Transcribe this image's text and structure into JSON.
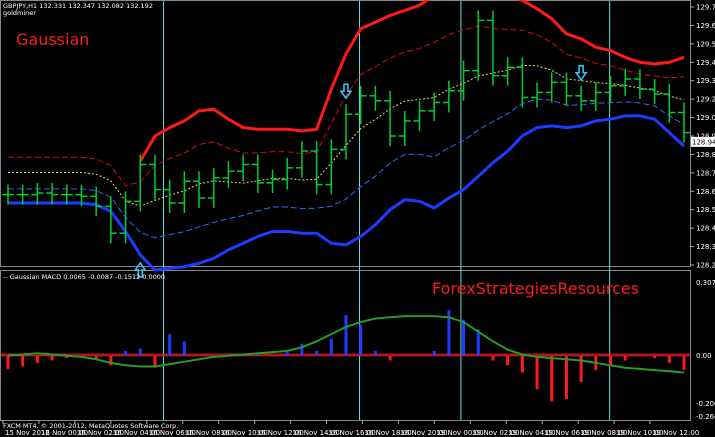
{
  "header": {
    "symbol_line": "GBPJPY,H1  132.331 132.347 132.082 132.192",
    "indicator_name": "goldminer",
    "sub_window_label": "-- Gaussian MACD 0.0065 -0.0087 -0.1512 0.0000",
    "footer": "FXCM MT4, © 2001-2012, MetaQuotes Software Corp."
  },
  "overlays": {
    "gaussian_text": "Gaussian",
    "brand_text": "ForexStrategiesResources",
    "accent_red": "#ff1a1a",
    "band_blue": "#1e3cff",
    "candle_green": "#00cc33",
    "arrow_cyan": "#33ccff",
    "vline_cyan": "#5fe0e0"
  },
  "price_axis": {
    "labels": [
      "129.750",
      "129.640",
      "129.530",
      "129.420",
      "129.310",
      "129.200",
      "129.090",
      "128.980",
      "128.870",
      "128.760",
      "128.650",
      "128.540",
      "128.430",
      "128.320",
      "128.210"
    ],
    "current_price": "128.945"
  },
  "macd_axis": {
    "labels": [
      "0.3075",
      "0.00",
      "-0.2000",
      "-0.2600"
    ]
  },
  "time_axis": {
    "labels": [
      "15 Nov 2012",
      "16 Nov 00:00",
      "16 Nov 02:00",
      "16 Nov 04:00",
      "16 Nov 06:00",
      "16 Nov 08:00",
      "16 Nov 10:00",
      "16 Nov 12:00",
      "16 Nov 14:00",
      "16 Nov 16:00",
      "16 Nov 18:00",
      "16 Nov 20:00",
      "19 Nov 00:00",
      "19 Nov 02:00",
      "19 Nov 04:00",
      "19 Nov 06:00",
      "19 Nov 08:00",
      "19 Nov 10:00",
      "19 Nov 12:00"
    ]
  },
  "chart_data": [
    {
      "type": "line",
      "title": "GBPJPY,H1",
      "ylim": [
        128.21,
        129.75
      ],
      "y_ticks": [
        129.75,
        129.64,
        129.53,
        129.42,
        129.31,
        129.2,
        129.09,
        128.98,
        128.87,
        128.76,
        128.65,
        128.54,
        128.43,
        128.32,
        128.21
      ],
      "x": [
        1,
        2,
        3,
        4,
        5,
        6,
        7,
        8,
        9,
        10,
        11,
        12,
        13,
        14,
        15,
        16,
        17,
        18,
        19,
        20,
        21,
        22,
        23,
        24,
        25,
        26,
        27,
        28,
        29,
        30,
        31,
        32,
        33,
        34,
        35,
        36,
        37,
        38,
        39,
        40,
        41,
        42,
        43,
        44,
        45,
        46,
        47
      ],
      "bars": [
        {
          "o": 128.63,
          "c": 128.63
        },
        {
          "o": 128.63,
          "c": 128.63
        },
        {
          "o": 128.63,
          "c": 128.64
        },
        {
          "o": 128.64,
          "c": 128.63
        },
        {
          "o": 128.63,
          "c": 128.63
        },
        {
          "o": 128.63,
          "c": 128.62
        },
        {
          "o": 128.62,
          "c": 128.56
        },
        {
          "o": 128.56,
          "c": 128.4
        },
        {
          "o": 128.4,
          "c": 128.59
        },
        {
          "o": 128.59,
          "c": 128.81
        },
        {
          "o": 128.81,
          "c": 128.66
        },
        {
          "o": 128.66,
          "c": 128.58
        },
        {
          "o": 128.58,
          "c": 128.71
        },
        {
          "o": 128.71,
          "c": 128.61
        },
        {
          "o": 128.61,
          "c": 128.73
        },
        {
          "o": 128.73,
          "c": 128.77
        },
        {
          "o": 128.77,
          "c": 128.81
        },
        {
          "o": 128.81,
          "c": 128.7
        },
        {
          "o": 128.7,
          "c": 128.72
        },
        {
          "o": 128.72,
          "c": 128.79
        },
        {
          "o": 128.79,
          "c": 128.89
        },
        {
          "o": 128.89,
          "c": 128.69
        },
        {
          "o": 128.69,
          "c": 128.9
        },
        {
          "o": 128.9,
          "c": 129.11
        },
        {
          "o": 129.11,
          "c": 129.22
        },
        {
          "o": 129.22,
          "c": 129.19
        },
        {
          "o": 129.19,
          "c": 128.98
        },
        {
          "o": 128.98,
          "c": 129.07
        },
        {
          "o": 129.07,
          "c": 129.13
        },
        {
          "o": 129.13,
          "c": 129.18
        },
        {
          "o": 129.18,
          "c": 129.25
        },
        {
          "o": 129.25,
          "c": 129.37
        },
        {
          "o": 129.37,
          "c": 129.67
        },
        {
          "o": 129.67,
          "c": 129.34
        },
        {
          "o": 129.34,
          "c": 129.39
        },
        {
          "o": 129.39,
          "c": 129.21
        },
        {
          "o": 129.21,
          "c": 129.24
        },
        {
          "o": 129.24,
          "c": 129.3
        },
        {
          "o": 129.3,
          "c": 129.22
        },
        {
          "o": 129.22,
          "c": 129.19
        },
        {
          "o": 129.19,
          "c": 129.24
        },
        {
          "o": 129.24,
          "c": 129.28
        },
        {
          "o": 129.28,
          "c": 129.32
        },
        {
          "o": 129.32,
          "c": 129.26
        },
        {
          "o": 129.26,
          "c": 129.23
        },
        {
          "o": 129.23,
          "c": 129.12
        },
        {
          "o": 129.12,
          "c": 129.0
        }
      ],
      "series": [
        {
          "name": "upper outer band",
          "color": "#ff1a1a",
          "values": [
            null,
            null,
            null,
            null,
            null,
            null,
            null,
            null,
            null,
            128.83,
            128.98,
            129.03,
            129.07,
            129.13,
            129.14,
            129.08,
            129.03,
            129.02,
            129.02,
            129.02,
            129.01,
            129.02,
            129.26,
            129.47,
            129.62,
            129.66,
            129.7,
            129.73,
            129.76,
            129.82,
            129.86,
            129.88,
            129.89,
            129.85,
            129.82,
            129.79,
            129.74,
            129.68,
            129.59,
            129.56,
            129.51,
            129.49,
            129.45,
            129.42,
            129.41,
            129.42,
            129.45
          ]
        },
        {
          "name": "lower outer band",
          "color": "#1e3cff",
          "values": [
            128.58,
            128.58,
            128.58,
            128.58,
            128.58,
            128.58,
            128.57,
            128.53,
            128.41,
            128.27,
            128.18,
            128.19,
            128.2,
            128.22,
            128.25,
            128.3,
            128.34,
            128.38,
            128.41,
            128.41,
            128.4,
            128.4,
            128.34,
            128.33,
            128.38,
            128.45,
            128.54,
            128.6,
            128.59,
            128.55,
            128.61,
            128.66,
            128.74,
            128.82,
            128.89,
            128.98,
            129.03,
            129.04,
            129.03,
            129.04,
            129.07,
            129.08,
            129.1,
            129.1,
            129.08,
            129.0,
            128.92
          ]
        }
      ],
      "annotations": [
        {
          "label": "Gaussian"
        },
        {
          "type": "buy-arrow",
          "x": 10
        },
        {
          "type": "sell-arrow",
          "x": 24
        },
        {
          "type": "sell-arrow",
          "x": 40
        }
      ]
    },
    {
      "type": "bar",
      "title": "Gaussian MACD",
      "ylim": [
        -0.26,
        0.3075
      ],
      "y_ticks": [
        0.3075,
        0.0,
        -0.2,
        -0.26
      ],
      "categories": [
        1,
        2,
        3,
        4,
        5,
        6,
        7,
        8,
        9,
        10,
        11,
        12,
        13,
        14,
        15,
        16,
        17,
        18,
        19,
        20,
        21,
        22,
        23,
        24,
        25,
        26,
        27,
        28,
        29,
        30,
        31,
        32,
        33,
        34,
        35,
        36,
        37,
        38,
        39,
        40,
        41,
        42,
        43,
        44,
        45,
        46,
        47
      ],
      "series": [
        {
          "name": "histogram",
          "values": [
            -0.055,
            -0.045,
            -0.03,
            -0.02,
            -0.01,
            -0.005,
            -0.015,
            -0.04,
            0.02,
            0.03,
            -0.05,
            0.09,
            0.06,
            0.0,
            0.0,
            0.0,
            0.01,
            0.01,
            0.0,
            0.015,
            0.05,
            0.02,
            0.07,
            0.17,
            0.13,
            0.02,
            -0.02,
            0.0,
            0.0,
            0.02,
            0.19,
            0.15,
            0.11,
            -0.02,
            -0.04,
            -0.07,
            -0.14,
            -0.19,
            -0.18,
            -0.11,
            -0.06,
            -0.04,
            -0.02,
            0.0,
            -0.01,
            -0.03,
            -0.06
          ]
        },
        {
          "name": "signal",
          "values": [
            0.0,
            0.005,
            0.01,
            0.005,
            0.0,
            -0.005,
            -0.015,
            -0.03,
            -0.04,
            -0.045,
            -0.045,
            -0.035,
            -0.025,
            -0.015,
            -0.005,
            0.0,
            0.005,
            0.01,
            0.015,
            0.02,
            0.035,
            0.06,
            0.09,
            0.12,
            0.14,
            0.155,
            0.16,
            0.165,
            0.165,
            0.165,
            0.16,
            0.14,
            0.1,
            0.06,
            0.025,
            0.005,
            -0.005,
            -0.01,
            -0.015,
            -0.02,
            -0.03,
            -0.04,
            -0.05,
            -0.055,
            -0.06,
            -0.065,
            -0.07
          ]
        }
      ]
    }
  ]
}
